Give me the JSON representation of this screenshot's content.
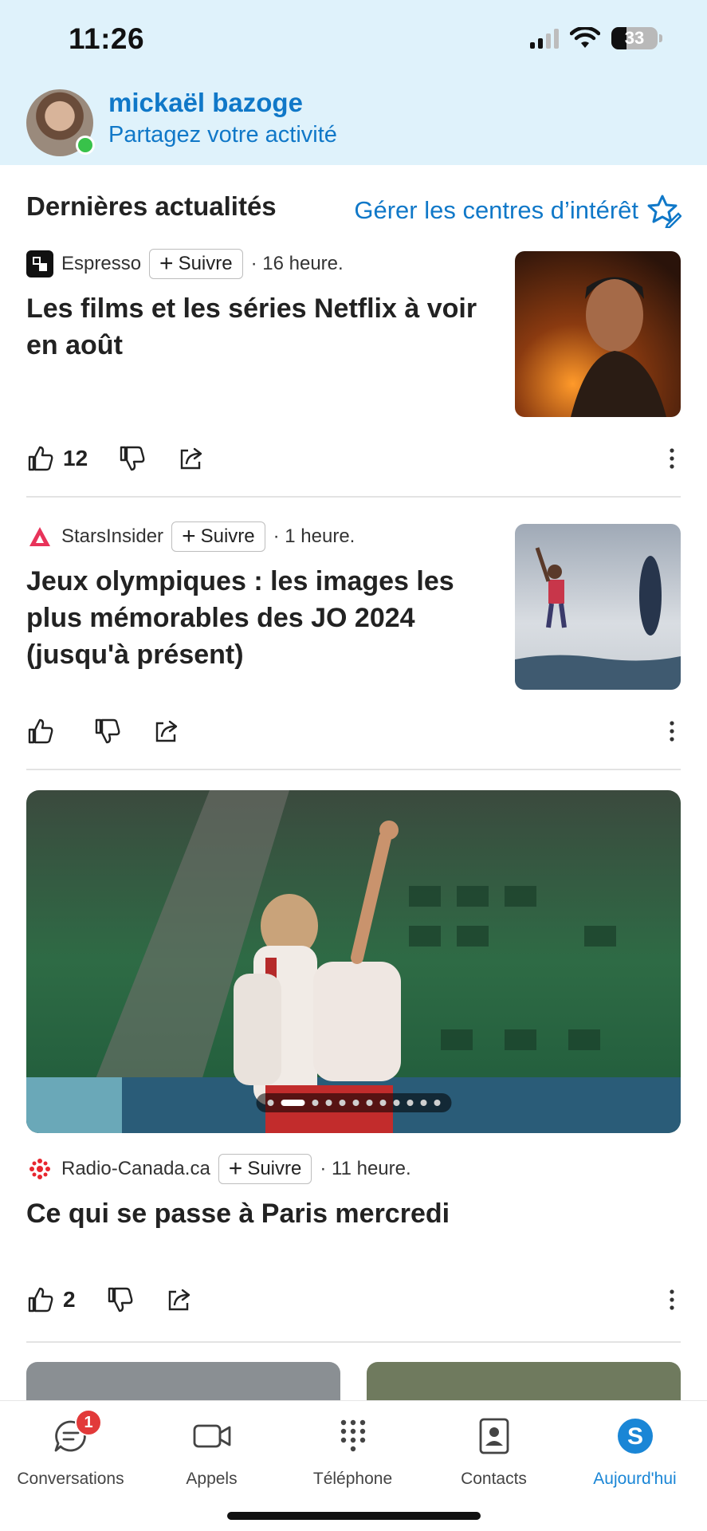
{
  "status_bar": {
    "time": "11:26",
    "battery": "33"
  },
  "header": {
    "user_name": "mickaël bazoge",
    "user_status": "Partagez votre activité"
  },
  "section": {
    "title": "Dernières actualités",
    "manage_label": "Gérer les centres d’intérêt"
  },
  "articles": [
    {
      "source": "Espresso",
      "follow": "Suivre",
      "time": "· 16 heure.",
      "headline": "Les films et les séries Netflix à voir en août",
      "likes": "12"
    },
    {
      "source": "StarsInsider",
      "follow": "Suivre",
      "time": "· 1 heure.",
      "headline": "Jeux olympiques : les images les plus mémorables des JO 2024 (jusqu'à présent)",
      "likes": ""
    },
    {
      "source": "Radio-Canada.ca",
      "follow": "Suivre",
      "time": "· 11 heure.",
      "headline": "Ce qui se passe à Paris mercredi",
      "likes": "2"
    }
  ],
  "carousel": {
    "pages": 12,
    "current": 2
  },
  "tabbar": {
    "items": [
      {
        "label": "Conversations",
        "icon": "chat-icon",
        "badge": "1"
      },
      {
        "label": "Appels",
        "icon": "video-icon"
      },
      {
        "label": "Téléphone",
        "icon": "dialpad-icon"
      },
      {
        "label": "Contacts",
        "icon": "contacts-icon"
      },
      {
        "label": "Aujourd'hui",
        "icon": "skype-icon"
      }
    ],
    "active": "Aujourd'hui"
  },
  "colors": {
    "accent": "#1078c8",
    "header_bg": "#dff2fb",
    "badge": "#e23a3a",
    "presence": "#38c24a"
  }
}
